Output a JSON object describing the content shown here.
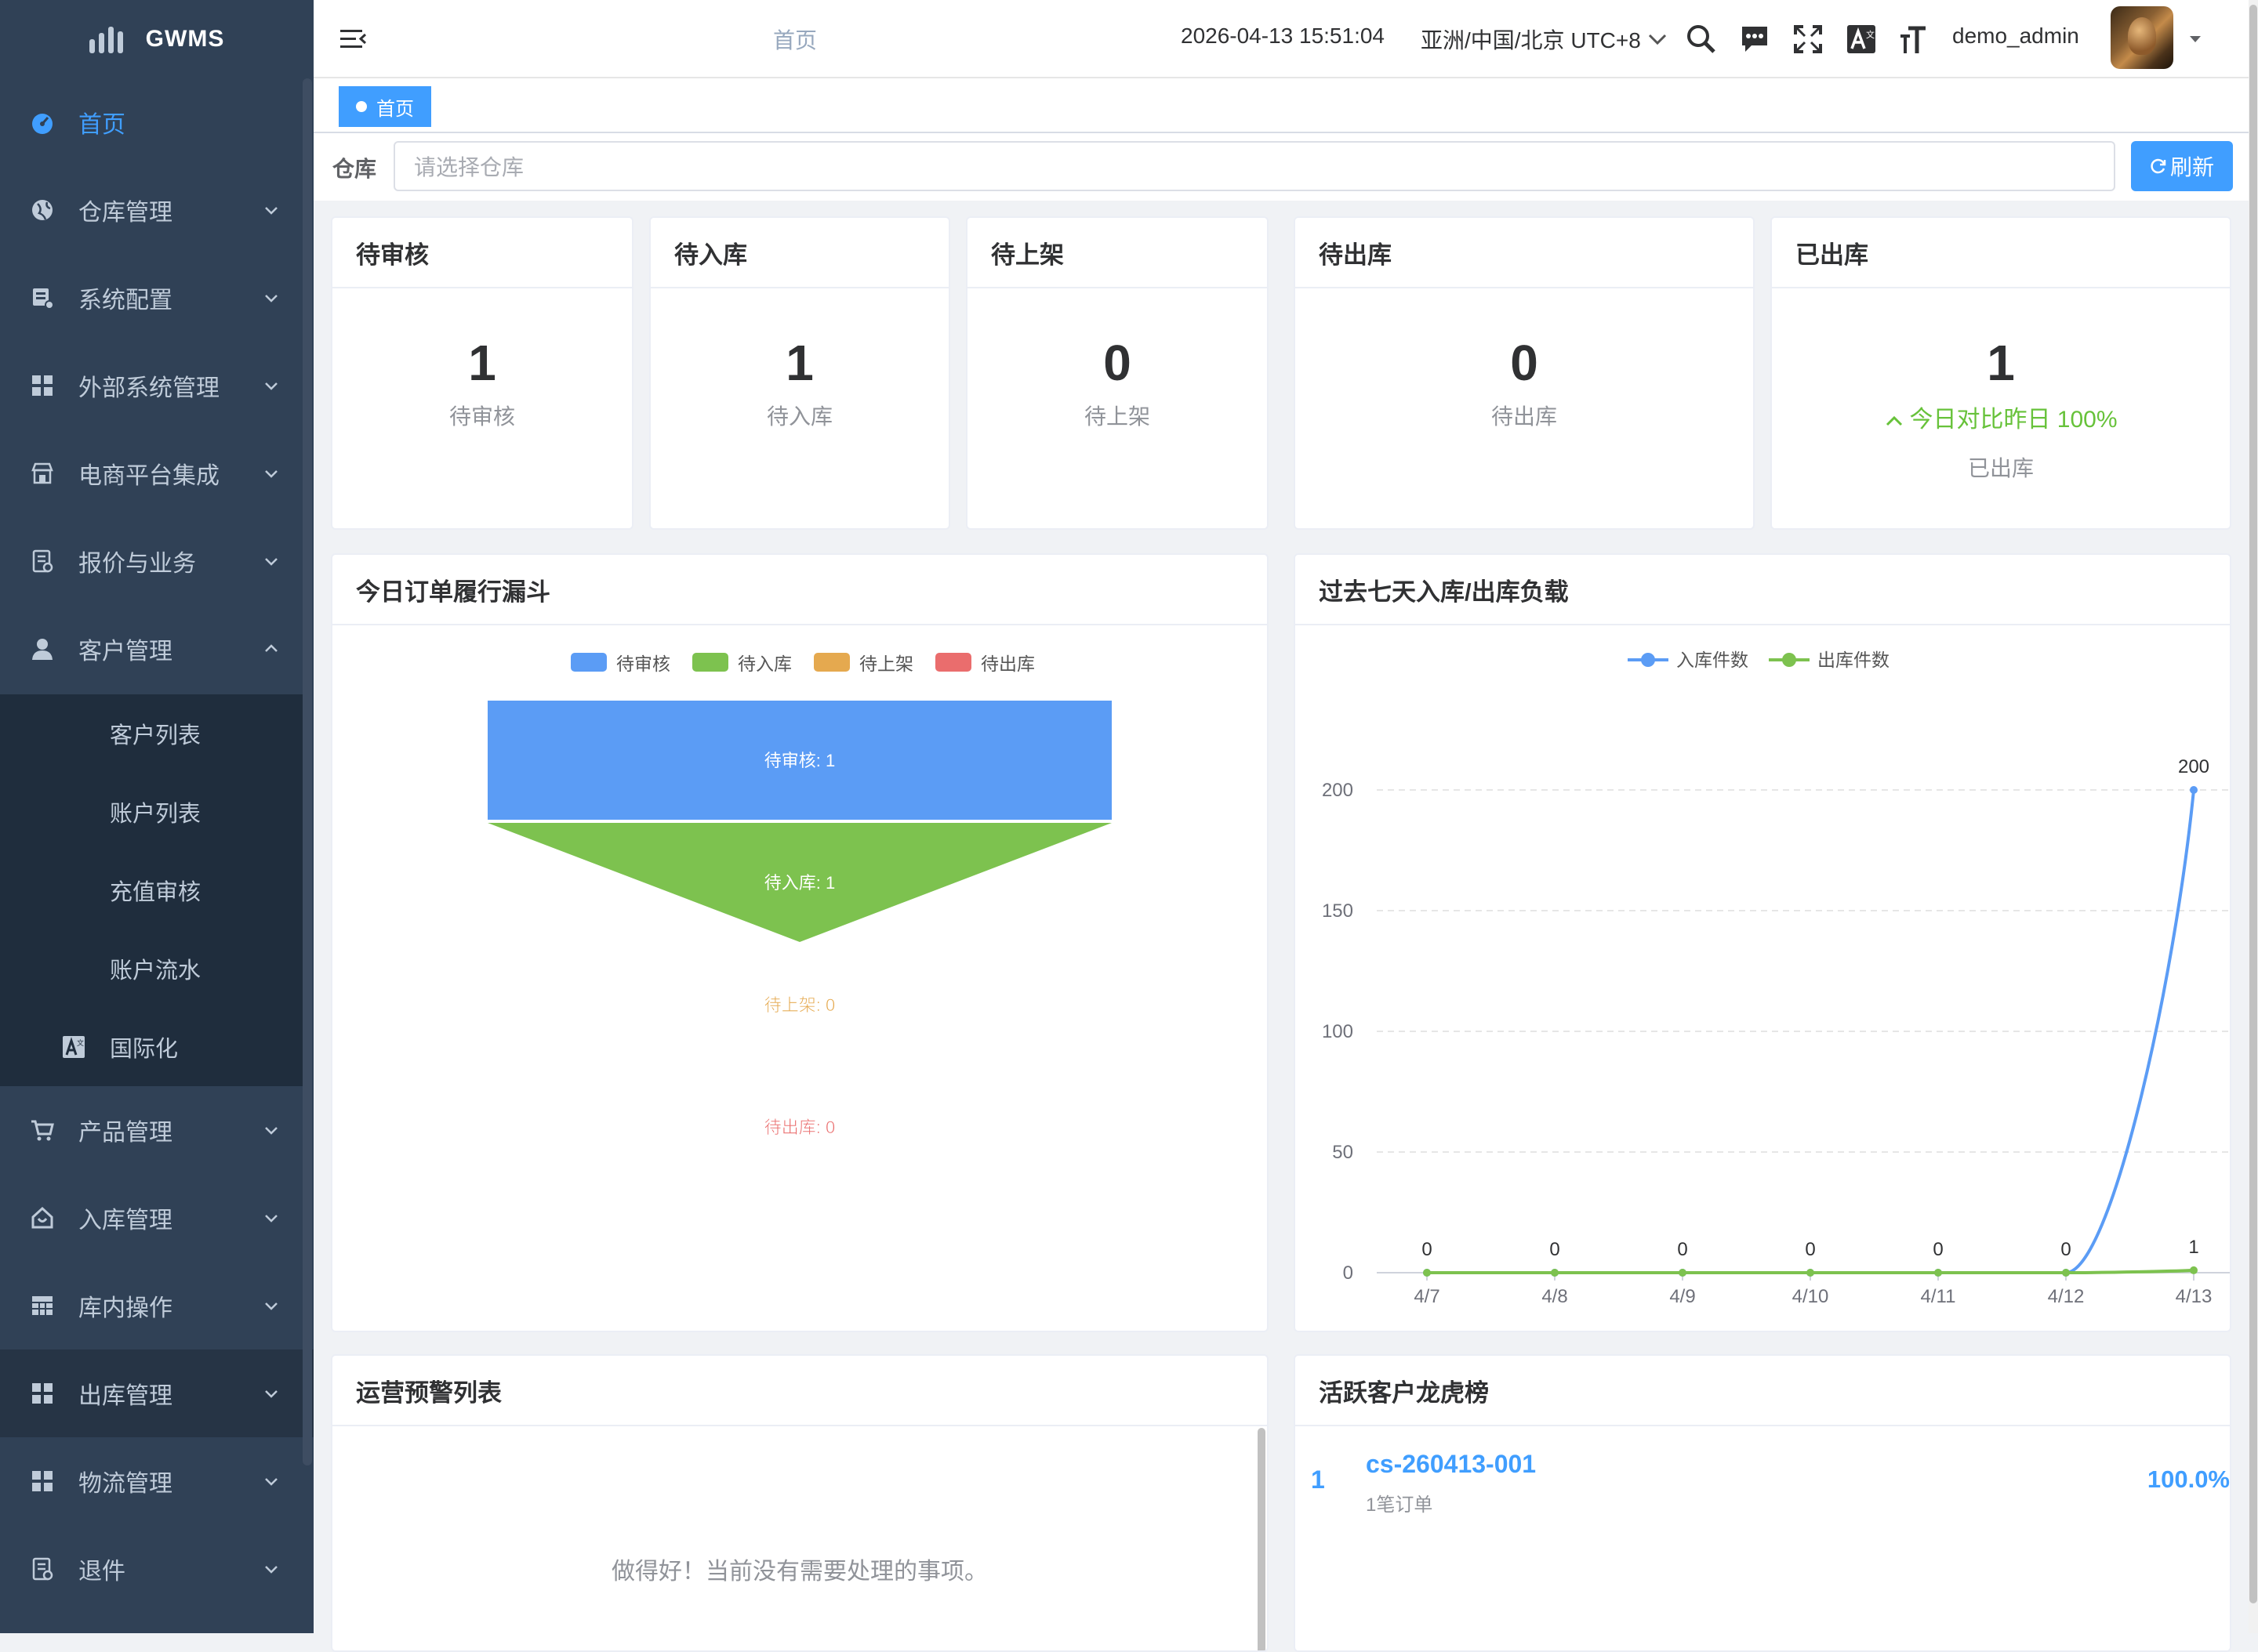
{
  "sidebar": {
    "brand": "GWMS",
    "items": [
      {
        "label": "首页",
        "icon": "dashboard-icon"
      },
      {
        "label": "仓库管理",
        "icon": "globe-icon"
      },
      {
        "label": "系统配置",
        "icon": "config-icon"
      },
      {
        "label": "外部系统管理",
        "icon": "grid-icon"
      },
      {
        "label": "电商平台集成",
        "icon": "shop-icon"
      },
      {
        "label": "报价与业务",
        "icon": "doc-icon"
      },
      {
        "label": "客户管理",
        "icon": "user-icon"
      },
      {
        "label": "产品管理",
        "icon": "cart-icon"
      },
      {
        "label": "入库管理",
        "icon": "home-icon"
      },
      {
        "label": "库内操作",
        "icon": "table-icon"
      },
      {
        "label": "出库管理",
        "icon": "grid-icon"
      },
      {
        "label": "物流管理",
        "icon": "grid-icon"
      },
      {
        "label": "退件",
        "icon": "doc-icon"
      }
    ],
    "sub_items": [
      "客户列表",
      "账户列表",
      "充值审核",
      "账户流水",
      "国际化"
    ]
  },
  "navbar": {
    "breadcrumb": "首页",
    "datetime": "2026-04-13 15:51:04",
    "timezone": "亚洲/中国/北京 UTC+8",
    "username": "demo_admin"
  },
  "tags": {
    "active": "首页"
  },
  "filter": {
    "label": "仓库",
    "placeholder": "请选择仓库",
    "refresh": "刷新"
  },
  "stats": [
    {
      "title": "待审核",
      "value": "1",
      "sub": "待审核"
    },
    {
      "title": "待入库",
      "value": "1",
      "sub": "待入库"
    },
    {
      "title": "待上架",
      "value": "0",
      "sub": "待上架"
    },
    {
      "title": "待出库",
      "value": "0",
      "sub": "待出库"
    },
    {
      "title": "已出库",
      "value": "1",
      "trend": "今日对比昨日 100%",
      "sub": "已出库"
    }
  ],
  "funnel_panel": {
    "title": "今日订单履行漏斗"
  },
  "line_panel": {
    "title": "过去七天入库/出库负载"
  },
  "alerts_panel": {
    "title": "运营预警列表",
    "empty": "做得好！当前没有需要处理的事项。"
  },
  "rank_panel": {
    "title": "活跃客户龙虎榜",
    "rows": [
      {
        "rank": "1",
        "name": "cs-260413-001",
        "orders": "1笔订单",
        "percent": "100.0%"
      }
    ]
  },
  "colors": {
    "primary": "#409eff",
    "green": "#67c23a",
    "sidebar": "#304156",
    "submenu": "#1f2d3d"
  },
  "chart_data": [
    {
      "type": "funnel",
      "legend_position": "top",
      "series": [
        {
          "name": "待审核",
          "value": 1,
          "label": "待审核: 1",
          "color": "#5b9cf5"
        },
        {
          "name": "待入库",
          "value": 1,
          "label": "待入库: 1",
          "color": "#7dc24f"
        },
        {
          "name": "待上架",
          "value": 0,
          "label": "待上架: 0",
          "color": "#e5a94f"
        },
        {
          "name": "待出库",
          "value": 0,
          "label": "待出库: 0",
          "color": "#ea6d6d"
        }
      ]
    },
    {
      "type": "line",
      "legend_position": "top",
      "x": [
        "4/7",
        "4/8",
        "4/9",
        "4/10",
        "4/11",
        "4/12",
        "4/13"
      ],
      "series": [
        {
          "name": "入库件数",
          "values": [
            0,
            0,
            0,
            0,
            0,
            0,
            200
          ],
          "color": "#5b9cf5"
        },
        {
          "name": "出库件数",
          "values": [
            0,
            0,
            0,
            0,
            0,
            0,
            1
          ],
          "color": "#7dc24f"
        }
      ],
      "yticks": [
        0,
        50,
        100,
        150,
        200
      ],
      "ylim": [
        0,
        200
      ],
      "grid": true
    }
  ]
}
